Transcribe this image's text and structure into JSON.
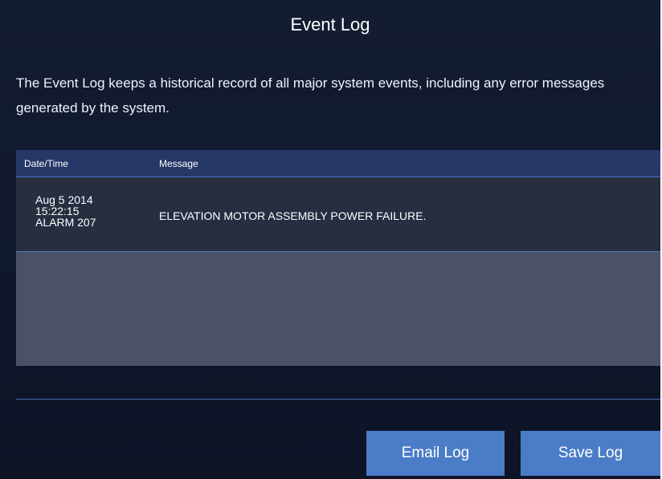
{
  "page": {
    "title": "Event Log",
    "description": "The Event Log keeps a historical record of all major system events, including any error messages generated by the system."
  },
  "table": {
    "columns": [
      "Date/Time",
      "Message"
    ],
    "rows": [
      {
        "date": "Aug 5 2014",
        "time": "15:22:15",
        "code": "ALARM 207",
        "message": "ELEVATION MOTOR ASSEMBLY POWER FAILURE."
      }
    ]
  },
  "buttons": {
    "email_label": "Email Log",
    "save_label": "Save Log"
  },
  "colors": {
    "background": "#141c33",
    "header_bar": "#263868",
    "row_background": "#262e40",
    "empty_area": "#4c5068",
    "divider": "#4a72c0",
    "button": "#4a7cc7"
  }
}
